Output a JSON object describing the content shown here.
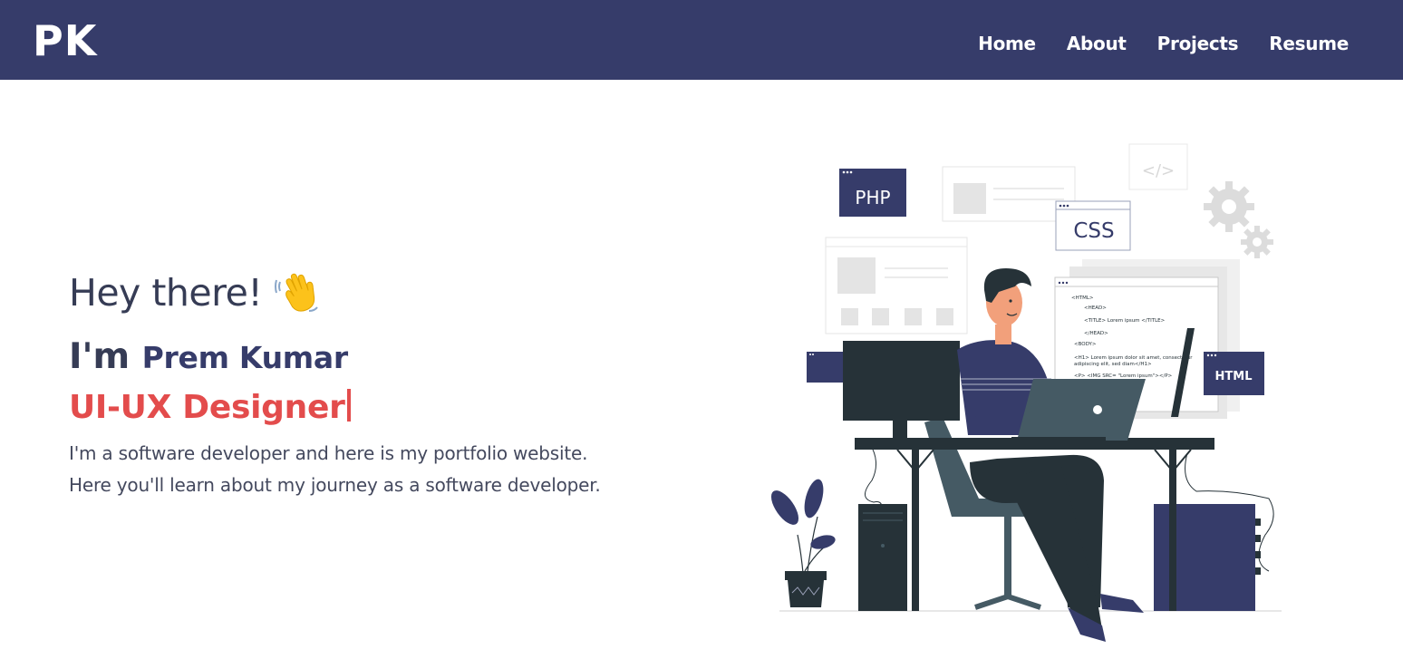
{
  "header": {
    "logo": "PK",
    "nav": [
      {
        "label": "Home"
      },
      {
        "label": "About"
      },
      {
        "label": "Projects"
      },
      {
        "label": "Resume"
      }
    ],
    "background": "#363c6a"
  },
  "hero": {
    "greeting": "Hey there!",
    "greeting_icon": "waving-hand-icon",
    "intro_prefix": "I'm",
    "name": "Prem Kumar",
    "role": "UI-UX Designer",
    "description_line1": "I'm a software developer and here is my portfolio website.",
    "description_line2": "Here you'll learn about my journey as a software developer."
  },
  "illustration": {
    "labels": {
      "php": "PHP",
      "css": "CSS",
      "html": "HTML",
      "code_icon": "</>"
    },
    "code_lines": [
      "<HTML>",
      "<HEAD>",
      "<TITLE> Lorem ipsum </TITLE>",
      "</HEAD>",
      "<BODY>",
      "<H1> Lorem ipsum dolor sit amet, consectetur",
      "adipiscing elit, sed diam</H1>",
      "<P> <IMG SRC= \"Lorem ipsum\"></P>"
    ]
  },
  "colors": {
    "primary": "#363c6a",
    "accent": "#e34c4c",
    "text": "#363c55"
  }
}
